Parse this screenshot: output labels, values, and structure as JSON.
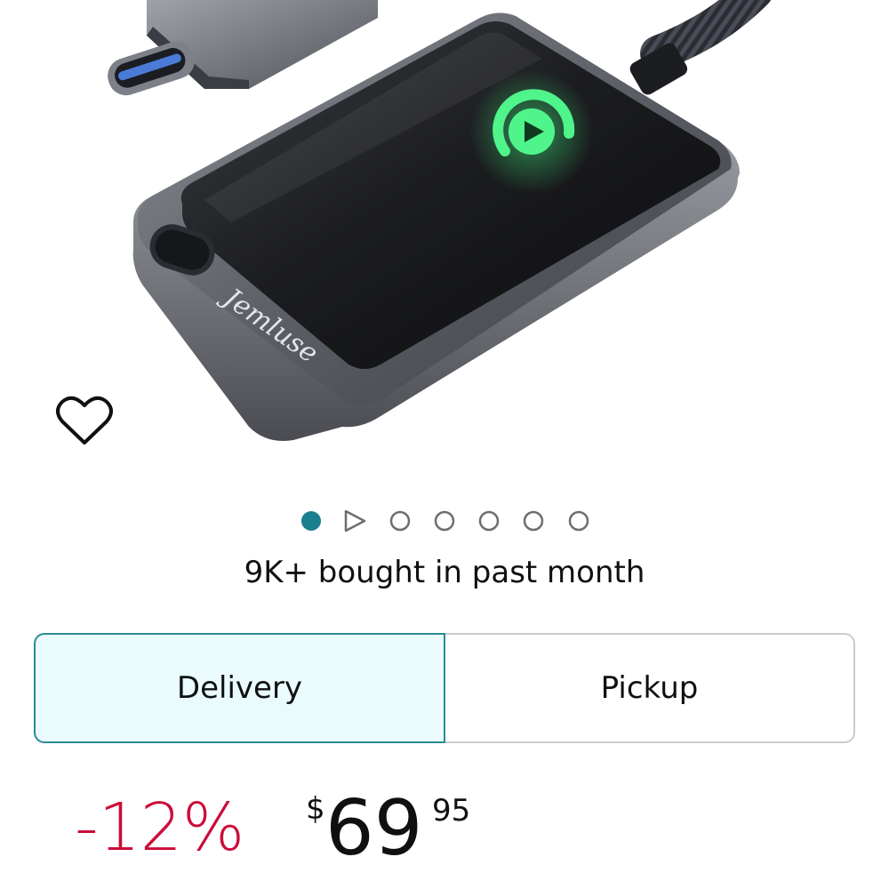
{
  "product": {
    "brand_mark": "Jemluse"
  },
  "carousel": {
    "total": 7,
    "active_index": 0,
    "video_index": 1
  },
  "social_proof": {
    "bought_text": "9K+ bought in past month"
  },
  "fulfillment": {
    "options": [
      "Delivery",
      "Pickup"
    ],
    "selected": "Delivery"
  },
  "price": {
    "discount": "-12%",
    "currency_symbol": "$",
    "whole": "69",
    "fraction": "95"
  },
  "colors": {
    "discount": "#cc0c39",
    "accent": "#2a8a99",
    "selected_bg": "#e9fbfd",
    "led_glow": "#3ff07f",
    "dot_active": "#1a7f8e"
  },
  "icons": {
    "wishlist": "heart-outline-icon",
    "video": "play-triangle-icon"
  }
}
